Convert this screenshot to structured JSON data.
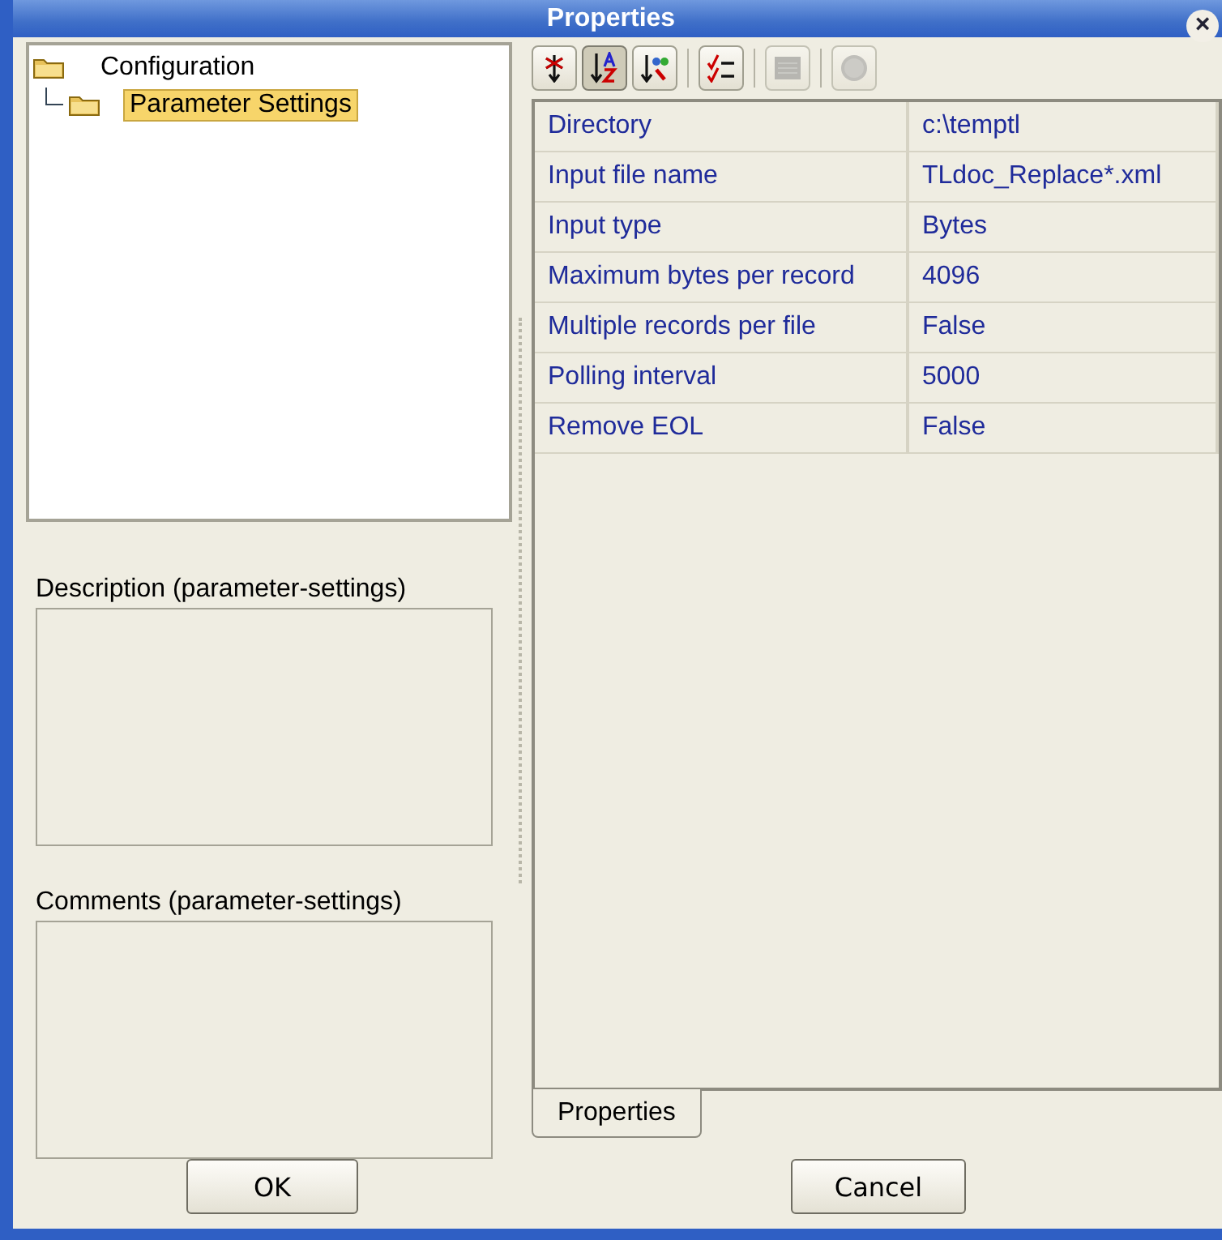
{
  "window": {
    "title": "Properties",
    "close": "×"
  },
  "tree": [
    {
      "label": "Configuration",
      "selected": false,
      "children": [
        {
          "label": "Parameter Settings",
          "selected": true
        }
      ]
    }
  ],
  "description": {
    "label": "Description (parameter-settings)"
  },
  "comments": {
    "label": "Comments (parameter-settings)"
  },
  "toolbar": [
    {
      "kind": "categorized",
      "selected": false,
      "disabled": false
    },
    {
      "kind": "sort-az",
      "selected": true,
      "disabled": false
    },
    {
      "kind": "sort-by-type",
      "selected": false,
      "disabled": false
    },
    {
      "kind": "checklist",
      "selected": false,
      "disabled": false
    },
    {
      "kind": "grid",
      "selected": false,
      "disabled": true
    },
    {
      "kind": "help",
      "selected": false,
      "disabled": true
    }
  ],
  "properties": [
    {
      "name": "Directory",
      "value": "c:\\temptl"
    },
    {
      "name": "Input file name",
      "value": "TLdoc_Replace*.xml"
    },
    {
      "name": "Input type",
      "value": "Bytes"
    },
    {
      "name": "Maximum bytes per record",
      "value": "4096"
    },
    {
      "name": "Multiple records per file",
      "value": "False"
    },
    {
      "name": "Polling interval",
      "value": "5000"
    },
    {
      "name": "Remove EOL",
      "value": "False"
    }
  ],
  "tabs": [
    {
      "label": "Properties",
      "selected": true
    }
  ],
  "buttons": {
    "ok": "OK",
    "cancel": "Cancel"
  }
}
